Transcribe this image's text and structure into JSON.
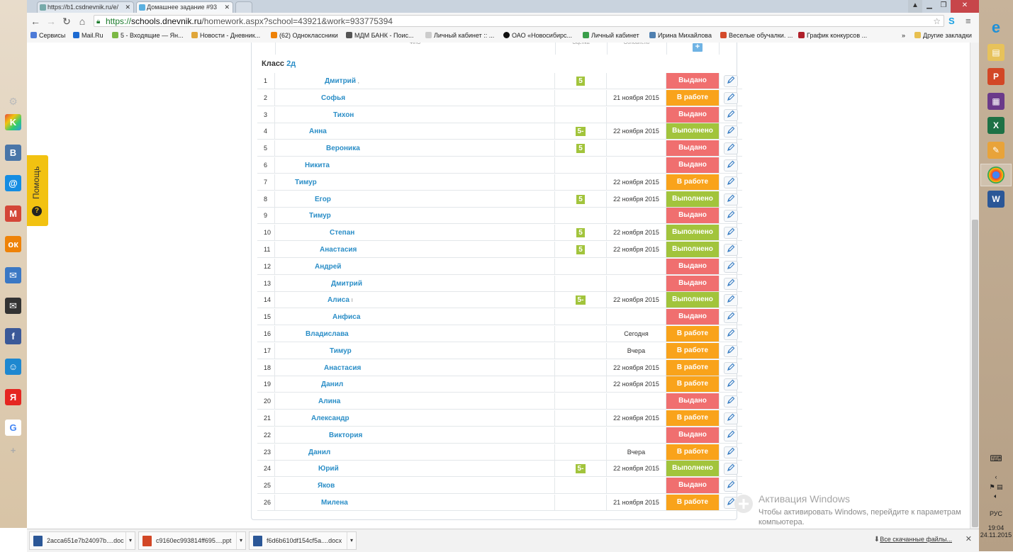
{
  "browser": {
    "tabs": [
      {
        "label": "https://b1.csdnevnik.ru/e/",
        "active": false
      },
      {
        "label": "Домашнее задание #93",
        "active": true
      }
    ],
    "address_secure": "https://",
    "address_host": "schools.dnevnik.ru",
    "address_path": "/homework.aspx?school=43921&work=933775394",
    "bookmarks": [
      {
        "label": "Сервисы",
        "color": "#4d7bd8"
      },
      {
        "label": "Mail.Ru",
        "color": "#1c6ad1"
      },
      {
        "label": "5 - Входящие — Ян...",
        "color": "#7bb844"
      },
      {
        "label": "Новости - Дневник...",
        "color": "#e0a63a"
      },
      {
        "label": "(62) Одноклассники",
        "color": "#ee8208"
      },
      {
        "label": "МДМ БАНК - Поис...",
        "color": "#555555"
      },
      {
        "label": "Личный кабинет :: ...",
        "color": "#999999"
      },
      {
        "label": "ОАО «Новосибирс...",
        "color": "#111111"
      },
      {
        "label": "Личный кабинет",
        "color": "#3a9e4a"
      },
      {
        "label": "Ирина Михайлова",
        "color": "#5080b0"
      },
      {
        "label": "Веселые обучалки. ...",
        "color": "#d44a2a"
      },
      {
        "label": "График конкурсов ...",
        "color": "#b0202a"
      },
      {
        "label": "»",
        "color": ""
      },
      {
        "label": "Другие закладки",
        "color": "#e8c050"
      }
    ]
  },
  "help_label": "Помощь",
  "table": {
    "header": {
      "fio": "ФИО",
      "grade": "Оценка",
      "updated": "Обновлено",
      "plus": "+"
    },
    "class_label": "Класс",
    "class_name": "2д",
    "rows": [
      {
        "num": "1",
        "name": "Дмитрий",
        "suffix": " ,",
        "grade": "5",
        "date": "",
        "status": "Выдано",
        "st": "issued",
        "indent": 70
      },
      {
        "num": "2",
        "name": "Софья",
        "grade": "",
        "date": "21 ноября 2015",
        "status": "В работе",
        "st": "work",
        "indent": 65
      },
      {
        "num": "3",
        "name": "Тихон",
        "grade": "",
        "date": "",
        "status": "Выдано",
        "st": "issued",
        "indent": 82
      },
      {
        "num": "4",
        "name": "Анна",
        "grade": "5-",
        "date": "22 ноября 2015",
        "status": "Выполнено",
        "st": "done",
        "indent": 48
      },
      {
        "num": "5",
        "name": "Вероника",
        "grade": "5",
        "date": "",
        "status": "Выдано",
        "st": "issued",
        "indent": 72
      },
      {
        "num": "6",
        "name": "Никита",
        "grade": "",
        "date": "",
        "status": "Выдано",
        "st": "issued",
        "indent": 42
      },
      {
        "num": "7",
        "name": "Тимур",
        "grade": "",
        "date": "22 ноября 2015",
        "status": "В работе",
        "st": "work",
        "indent": 28
      },
      {
        "num": "8",
        "name": "Егор",
        "grade": "5",
        "date": "22 ноября 2015",
        "status": "Выполнено",
        "st": "done",
        "indent": 56
      },
      {
        "num": "9",
        "name": "Тимур",
        "grade": "",
        "date": "",
        "status": "Выдано",
        "st": "issued",
        "indent": 48
      },
      {
        "num": "10",
        "name": "Степан",
        "grade": "5",
        "date": "22 ноября 2015",
        "status": "Выполнено",
        "st": "done",
        "indent": 77
      },
      {
        "num": "11",
        "name": "Анастасия",
        "grade": "5",
        "date": "22 ноября 2015",
        "status": "Выполнено",
        "st": "done",
        "indent": 63
      },
      {
        "num": "12",
        "name": "Андрей",
        "grade": "",
        "date": "",
        "status": "Выдано",
        "st": "issued",
        "indent": 56
      },
      {
        "num": "13",
        "name": "Дмитрий",
        "grade": "",
        "date": "",
        "status": "Выдано",
        "st": "issued",
        "indent": 79
      },
      {
        "num": "14",
        "name": "Алиса",
        "suffix": " ı",
        "grade": "5-",
        "date": "22 ноября 2015",
        "status": "Выполнено",
        "st": "done",
        "indent": 74
      },
      {
        "num": "15",
        "name": "Анфиса",
        "grade": "",
        "date": "",
        "status": "Выдано",
        "st": "issued",
        "indent": 81
      },
      {
        "num": "16",
        "name": "Владислава",
        "grade": "",
        "date": "Сегодня",
        "status": "В работе",
        "st": "work",
        "indent": 43
      },
      {
        "num": "17",
        "name": "Тимур",
        "grade": "",
        "date": "Вчера",
        "status": "В работе",
        "st": "work",
        "indent": 77
      },
      {
        "num": "18",
        "name": "Анастасия",
        "grade": "",
        "date": "22 ноября 2015",
        "status": "В работе",
        "st": "work",
        "indent": 69
      },
      {
        "num": "19",
        "name": "Данил",
        "grade": "",
        "date": "22 ноября 2015",
        "status": "В работе",
        "st": "work",
        "indent": 65
      },
      {
        "num": "20",
        "name": "Алина",
        "grade": "",
        "date": "",
        "status": "Выдано",
        "st": "issued",
        "indent": 61
      },
      {
        "num": "21",
        "name": "Александр",
        "grade": "",
        "date": "22 ноября 2015",
        "status": "В работе",
        "st": "work",
        "indent": 51
      },
      {
        "num": "22",
        "name": "Виктория",
        "grade": "",
        "date": "",
        "status": "Выдано",
        "st": "issued",
        "indent": 76
      },
      {
        "num": "23",
        "name": "Данил",
        "grade": "",
        "date": "Вчера",
        "status": "В работе",
        "st": "work",
        "indent": 47
      },
      {
        "num": "24",
        "name": "Юрий",
        "grade": "5-",
        "date": "22 ноября 2015",
        "status": "Выполнено",
        "st": "done",
        "indent": 61
      },
      {
        "num": "25",
        "name": "Яков",
        "grade": "",
        "date": "",
        "status": "Выдано",
        "st": "issued",
        "indent": 60
      },
      {
        "num": "26",
        "name": "Милена",
        "grade": "",
        "date": "21 ноября 2015",
        "status": "В работе",
        "st": "work",
        "indent": 65
      }
    ]
  },
  "activation": {
    "title": "Активация Windows",
    "text": "Чтобы активировать Windows, перейдите к параметрам компьютера."
  },
  "downloads": {
    "items": [
      {
        "label": "2acca651e7b24097b....doc",
        "color": "#2b5797"
      },
      {
        "label": "c9160ec993814ff695....ppt",
        "color": "#d24726"
      },
      {
        "label": "f6d6b610df154cf5a....docx",
        "color": "#2b5797"
      }
    ],
    "all_label": "Все скачанные файлы...",
    "close": "✕"
  },
  "tray": {
    "lang": "РУС",
    "time": "19:04",
    "date": "24.11.2015"
  },
  "colors": {
    "issued": "#f06f6f",
    "work": "#f9a31b",
    "done": "#a2c43c",
    "link": "#2b8ec7"
  }
}
